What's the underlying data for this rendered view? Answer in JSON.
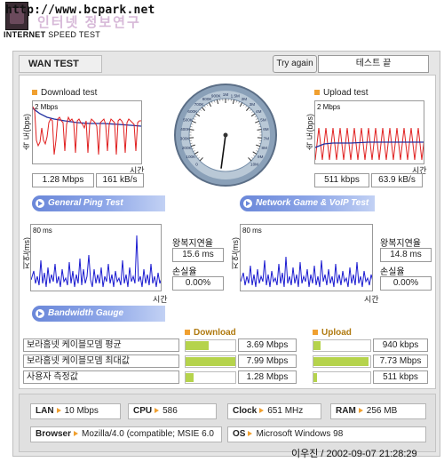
{
  "header": {
    "url": "http://www.bcpark.net",
    "logo_text": "인터넷 정보연구",
    "speedtest_bold": "INTERNET",
    "speedtest_thin": "SPEED TEST"
  },
  "toolbar": {
    "wan_test_tab": "WAN TEST",
    "try_again": "Try again",
    "status": "테스트 끝"
  },
  "download": {
    "title": "Download test",
    "ylabel": "속 도(bps)",
    "ymax": "2 Mbps",
    "xlabel": "시간",
    "mbps": "1.28 Mbps",
    "kbs": "161 kB/s"
  },
  "upload": {
    "title": "Upload test",
    "ylabel": "속 도(bps)",
    "ymax": "2 Mbps",
    "xlabel": "시간",
    "kbps": "511 kbps",
    "kbs": "63.9 kB/s"
  },
  "ping": {
    "banner": "General Ping Test",
    "ylabel": "지연(ms)",
    "ymax": "80 ms",
    "xlabel": "시간",
    "rtt_label": "왕복지연율",
    "rtt": "15.6 ms",
    "loss_label": "손실율",
    "loss": "0.00%"
  },
  "netgame": {
    "banner": "Network Game & VoIP Test",
    "ylabel": "지연(ms)",
    "ymax": "80 ms",
    "xlabel": "시간",
    "rtt_label": "왕복지연율",
    "rtt": "14.8 ms",
    "loss_label": "손실율",
    "loss": "0.00%"
  },
  "gauge": {
    "ticks": [
      "0",
      "100K",
      "200K",
      "300K",
      "400K",
      "500K",
      "600K",
      "700K",
      "800K",
      "900K",
      "1M",
      "1.5M",
      "2M",
      "3M",
      "4M",
      "5M",
      "6M",
      "7M",
      "8M",
      "9M",
      "10M"
    ],
    "needle_value": "1.28M"
  },
  "bandwidth": {
    "banner": "Bandwidth Gauge",
    "download_header": "Download",
    "upload_header": "Upload",
    "rows": [
      {
        "label": "보라홈넷 케이블모뎀 평균",
        "down": "3.69 Mbps",
        "down_frac": 0.46,
        "up": "940 kbps",
        "up_frac": 0.12
      },
      {
        "label": "보라홈넷 케이블모뎀 최대값",
        "down": "7.99 Mbps",
        "down_frac": 1.0,
        "up": "7.73 Mbps",
        "up_frac": 0.97
      },
      {
        "label": "사용자 측정값",
        "down": "1.28 Mbps",
        "down_frac": 0.16,
        "up": "511 kbps",
        "up_frac": 0.07
      }
    ]
  },
  "system": {
    "lan_key": "LAN",
    "lan": "10 Mbps",
    "cpu_key": "CPU",
    "cpu": "586",
    "clock_key": "Clock",
    "clock": "651 MHz",
    "ram_key": "RAM",
    "ram": "256 MB",
    "browser_key": "Browser",
    "browser": "Mozilla/4.0 (compatible; MSIE 6.0",
    "os_key": "OS",
    "os": "Microsoft Windows 98"
  },
  "footer": {
    "text": "이우진 / 2002-09-07 21:28:29"
  },
  "colors": {
    "download_line": "#e02020",
    "avg_line": "#2030a0",
    "ping_line": "#1a1ad0",
    "bar_fill": "#b5d34c",
    "accent": "#f0a030"
  }
}
